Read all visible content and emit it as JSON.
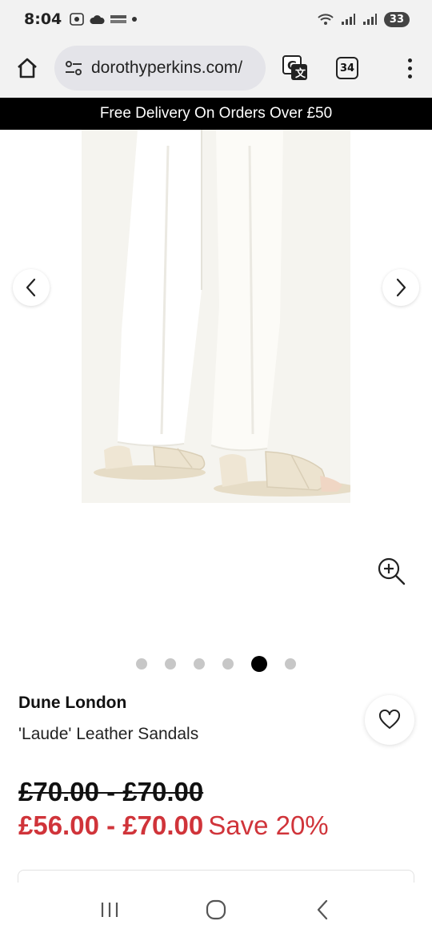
{
  "status_bar": {
    "time": "8:04",
    "battery": "33"
  },
  "browser": {
    "url": "dorothyperkins.com/",
    "tab_count": "34"
  },
  "promo": {
    "text": "Free Delivery On Orders Over £50"
  },
  "gallery": {
    "image_count": 6,
    "active_index": 4,
    "image_subject": "white wide-leg jeans with cream leather strap sandals"
  },
  "product": {
    "brand": "Dune London",
    "name": "'Laude' Leather Sandals",
    "price_was": "£70.00 - £70.00",
    "price_now": "£56.00 - £70.00",
    "save": "Save 20%"
  },
  "colors": {
    "sale_red": "#d0343a",
    "promo_bg": "#000000",
    "chrome_bg": "#f2f2f2"
  },
  "icons": {
    "home": "home-icon",
    "site_info": "site-settings-icon",
    "translate": "translate-icon",
    "menu": "more-vert-icon",
    "prev": "chevron-left-icon",
    "next": "chevron-right-icon",
    "zoom": "zoom-in-icon",
    "wishlist": "heart-icon"
  }
}
